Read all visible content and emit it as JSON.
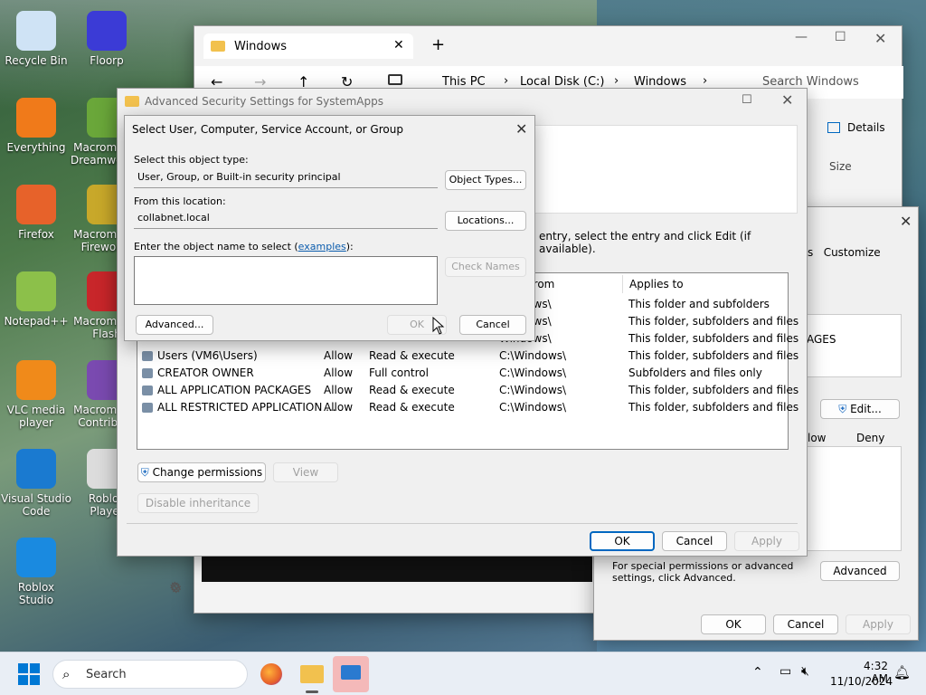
{
  "desktop": {
    "icons": [
      {
        "label": "Recycle Bin",
        "color": "#cfe3f5"
      },
      {
        "label": "Floorp",
        "color": "#3b3bd6"
      },
      {
        "label": "Everything",
        "color": "#f07a1a"
      },
      {
        "label": "Macromedia Dreamweaver",
        "color": "#6aa73a"
      },
      {
        "label": "Firefox",
        "color": "#e7622a"
      },
      {
        "label": "Macromedia Fireworks",
        "color": "#c8a82a"
      },
      {
        "label": "Notepad++",
        "color": "#8cc04a"
      },
      {
        "label": "Macromedia Flash",
        "color": "#c8262a"
      },
      {
        "label": "VLC media player",
        "color": "#f08a1a"
      },
      {
        "label": "Macromedia Contribute",
        "color": "#7a4ab0"
      },
      {
        "label": "Visual Studio Code",
        "color": "#1a7ad0"
      },
      {
        "label": "Roblox Player",
        "color": "#dcdcdc"
      },
      {
        "label": "Roblox Studio",
        "color": "#1a8ae0"
      }
    ]
  },
  "explorer": {
    "tab_title": "Windows",
    "breadcrumb": [
      "This PC",
      "Local Disk (C:)",
      "Windows"
    ],
    "search_placeholder": "Search Windows",
    "details_label": "Details",
    "size_col": "Size"
  },
  "props_dialog": {
    "tab_customize": "s   Customize",
    "list_item": "AGES",
    "edit_btn": "Edit...",
    "allow_col": "low",
    "deny_col": "Deny",
    "special_text": "For special permissions or advanced settings, click Advanced.",
    "advanced_btn": "Advanced",
    "ok": "OK",
    "cancel": "Cancel",
    "apply": "Apply"
  },
  "adv_security": {
    "title": "Advanced Security Settings for SystemApps",
    "instruction": "entry, select the entry and click Edit (if available).",
    "columns": {
      "from": "d from",
      "applies": "Applies to"
    },
    "rows": [
      {
        "principal": "",
        "access_type": "",
        "access": "",
        "from": "Windows\\",
        "applies": "This folder and subfolders"
      },
      {
        "principal": "",
        "access_type": "",
        "access": "",
        "from": "Windows\\",
        "applies": "This folder, subfolders and files"
      },
      {
        "principal": "",
        "access_type": "",
        "access": "",
        "from": "Windows\\",
        "applies": "This folder, subfolders and files"
      },
      {
        "principal": "Users (VM6\\Users)",
        "access_type": "Allow",
        "access": "Read & execute",
        "from": "C:\\Windows\\",
        "applies": "This folder, subfolders and files"
      },
      {
        "principal": "CREATOR OWNER",
        "access_type": "Allow",
        "access": "Full control",
        "from": "C:\\Windows\\",
        "applies": "Subfolders and files only"
      },
      {
        "principal": "ALL APPLICATION PACKAGES",
        "access_type": "Allow",
        "access": "Read & execute",
        "from": "C:\\Windows\\",
        "applies": "This folder, subfolders and files"
      },
      {
        "principal": "ALL RESTRICTED APPLICATION ...",
        "access_type": "Allow",
        "access": "Read & execute",
        "from": "C:\\Windows\\",
        "applies": "This folder, subfolders and files"
      }
    ],
    "change_permissions": "Change permissions",
    "view": "View",
    "disable_inheritance": "Disable inheritance",
    "ok": "OK",
    "cancel": "Cancel",
    "apply": "Apply"
  },
  "select_dialog": {
    "title": "Select User, Computer, Service Account, or Group",
    "object_type_label": "Select this object type:",
    "object_type_value": "User, Group, or Built-in security principal",
    "object_types_btn": "Object Types...",
    "location_label": "From this location:",
    "location_value": "collabnet.local",
    "locations_btn": "Locations...",
    "enter_label": "Enter the object name to select (",
    "examples_link": "examples",
    "enter_label_end": "):",
    "check_names_btn": "Check Names",
    "advanced_btn": "Advanced...",
    "ok": "OK",
    "cancel": "Cancel"
  },
  "taskbar": {
    "search_label": "Search",
    "time": "4:32 AM",
    "date": "11/10/2024"
  }
}
